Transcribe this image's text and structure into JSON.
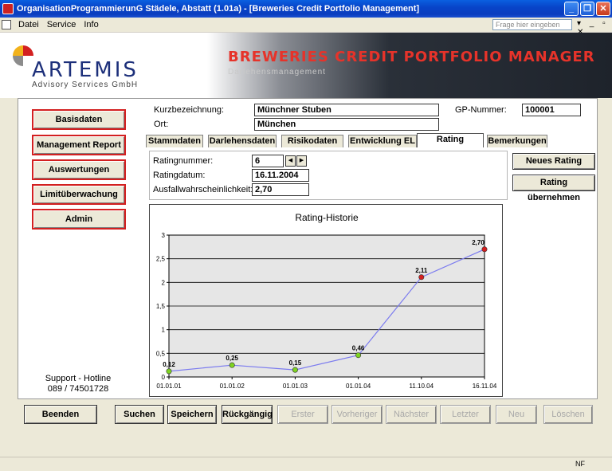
{
  "window": {
    "title": "OrganisationProgrammierunG Städele, Abstatt (1.01a) - [Breweries Credit Portfolio Management]"
  },
  "menu": {
    "items": [
      "Datei",
      "Service",
      "Info"
    ],
    "help_placeholder": "Frage hier eingeben"
  },
  "header": {
    "logo_name": "ARTEMIS",
    "logo_sub": "Advisory Services GmbH",
    "app_title": "BREWERIES CREDIT PORTFOLIO MANAGER",
    "app_subtitle": "Darlehensmanagement"
  },
  "nav": {
    "items": [
      "Basisdaten",
      "Management Report",
      "Auswertungen",
      "Limitüberwachung",
      "Admin"
    ],
    "hotline_label": "Support - Hotline",
    "hotline_number": "089 / 74501728"
  },
  "customer": {
    "short_label": "Kurzbezeichnung:",
    "short_value": "Münchner Stuben",
    "city_label": "Ort:",
    "city_value": "München",
    "gp_label": "GP-Nummer:",
    "gp_value": "100001"
  },
  "tabs": [
    "Stammdaten",
    "Darlehensdaten",
    "Risikodaten",
    "Entwicklung EL",
    "Rating",
    "Bemerkungen"
  ],
  "active_tab": "Rating",
  "rating": {
    "number_label": "Ratingnummer:",
    "number_value": "6",
    "date_label": "Ratingdatum:",
    "date_value": "16.11.2004",
    "prob_label": "Ausfallwahrscheinlichkeit:",
    "prob_value": "2,70",
    "new_button": "Neues Rating",
    "apply_button": "Rating übernehmen"
  },
  "chart_data": {
    "type": "line",
    "title": "Rating-Historie",
    "categories": [
      "01.01.01",
      "01.01.02",
      "01.01.03",
      "01.01.04",
      "11.10.04",
      "16.11.04"
    ],
    "values": [
      0.12,
      0.25,
      0.15,
      0.46,
      2.11,
      2.7
    ],
    "data_labels": [
      "0,12",
      "0,25",
      "0,15",
      "0,46",
      "2,11",
      "2,70"
    ],
    "yticks": [
      "0",
      "0,5",
      "1",
      "1,5",
      "2",
      "2,5",
      "3"
    ],
    "ylim": [
      0,
      3
    ],
    "grid": true,
    "line_color": "#7b7bef",
    "point_colors": [
      "#7ed321",
      "#7ed321",
      "#7ed321",
      "#7ed321",
      "#d42020",
      "#d42020"
    ],
    "plot_background": "#e6e6e6"
  },
  "toolbar": {
    "buttons": [
      "Beenden",
      "Suchen",
      "Speichern",
      "Rückgängig",
      "Erster",
      "Vorheriger",
      "Nächster",
      "Letzter",
      "Neu",
      "Löschen"
    ]
  },
  "status": {
    "right_text": "NF"
  }
}
